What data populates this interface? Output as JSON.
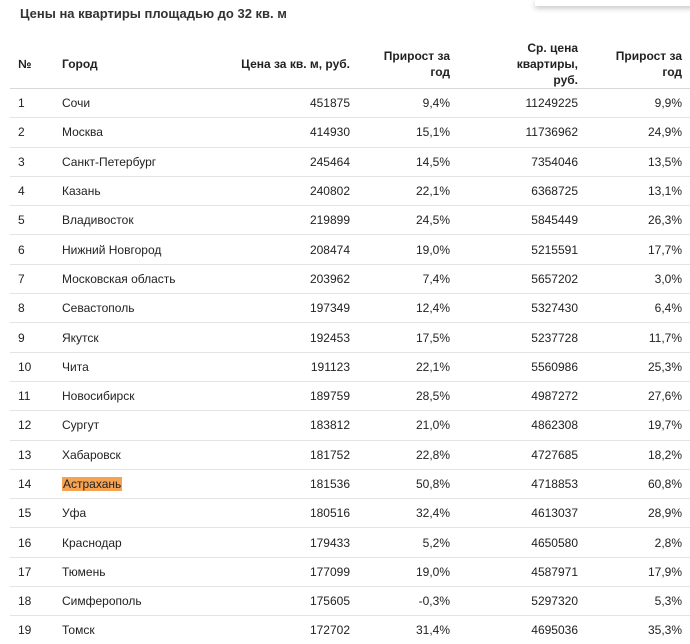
{
  "title": "Цены на квартиры площадью до 32 кв. м",
  "highlight_color": "#f5a252",
  "columns": {
    "num": "№",
    "city": "Город",
    "price": "Цена за кв. м, руб.",
    "growth": "Прирост за год",
    "avg_line1": "Ср. цена квартиры,",
    "avg_line2": "руб.",
    "growth2": "Прирост за год"
  },
  "rows": [
    {
      "num": "1",
      "city": "Сочи",
      "price": "451875",
      "growth": "9,4%",
      "avg": "11249225",
      "growth2": "9,9%"
    },
    {
      "num": "2",
      "city": "Москва",
      "price": "414930",
      "growth": "15,1%",
      "avg": "11736962",
      "growth2": "24,9%"
    },
    {
      "num": "3",
      "city": "Санкт-Петербург",
      "price": "245464",
      "growth": "14,5%",
      "avg": "7354046",
      "growth2": "13,5%"
    },
    {
      "num": "4",
      "city": "Казань",
      "price": "240802",
      "growth": "22,1%",
      "avg": "6368725",
      "growth2": "13,1%"
    },
    {
      "num": "5",
      "city": "Владивосток",
      "price": "219899",
      "growth": "24,5%",
      "avg": "5845449",
      "growth2": "26,3%"
    },
    {
      "num": "6",
      "city": "Нижний Новгород",
      "price": "208474",
      "growth": "19,0%",
      "avg": "5215591",
      "growth2": "17,7%"
    },
    {
      "num": "7",
      "city": "Московская область",
      "price": "203962",
      "growth": "7,4%",
      "avg": "5657202",
      "growth2": "3,0%"
    },
    {
      "num": "8",
      "city": "Севастополь",
      "price": "197349",
      "growth": "12,4%",
      "avg": "5327430",
      "growth2": "6,4%"
    },
    {
      "num": "9",
      "city": "Якутск",
      "price": "192453",
      "growth": "17,5%",
      "avg": "5237728",
      "growth2": "11,7%"
    },
    {
      "num": "10",
      "city": "Чита",
      "price": "191123",
      "growth": "22,1%",
      "avg": "5560986",
      "growth2": "25,3%"
    },
    {
      "num": "11",
      "city": "Новосибирск",
      "price": "189759",
      "growth": "28,5%",
      "avg": "4987272",
      "growth2": "27,6%"
    },
    {
      "num": "12",
      "city": "Сургут",
      "price": "183812",
      "growth": "21,0%",
      "avg": "4862308",
      "growth2": "19,7%"
    },
    {
      "num": "13",
      "city": "Хабаровск",
      "price": "181752",
      "growth": "22,8%",
      "avg": "4727685",
      "growth2": "18,2%"
    },
    {
      "num": "14",
      "city": "Астрахань",
      "price": "181536",
      "growth": "50,8%",
      "avg": "4718853",
      "growth2": "60,8%",
      "highlight": true
    },
    {
      "num": "15",
      "city": "Уфа",
      "price": "180516",
      "growth": "32,4%",
      "avg": "4613037",
      "growth2": "28,9%"
    },
    {
      "num": "16",
      "city": "Краснодар",
      "price": "179433",
      "growth": "5,2%",
      "avg": "4650580",
      "growth2": "2,8%"
    },
    {
      "num": "17",
      "city": "Тюмень",
      "price": "177099",
      "growth": "19,0%",
      "avg": "4587971",
      "growth2": "17,9%"
    },
    {
      "num": "18",
      "city": "Симферополь",
      "price": "175605",
      "growth": "-0,3%",
      "avg": "5297320",
      "growth2": "5,3%"
    },
    {
      "num": "19",
      "city": "Томск",
      "price": "172702",
      "growth": "31,4%",
      "avg": "4695036",
      "growth2": "35,3%"
    }
  ]
}
